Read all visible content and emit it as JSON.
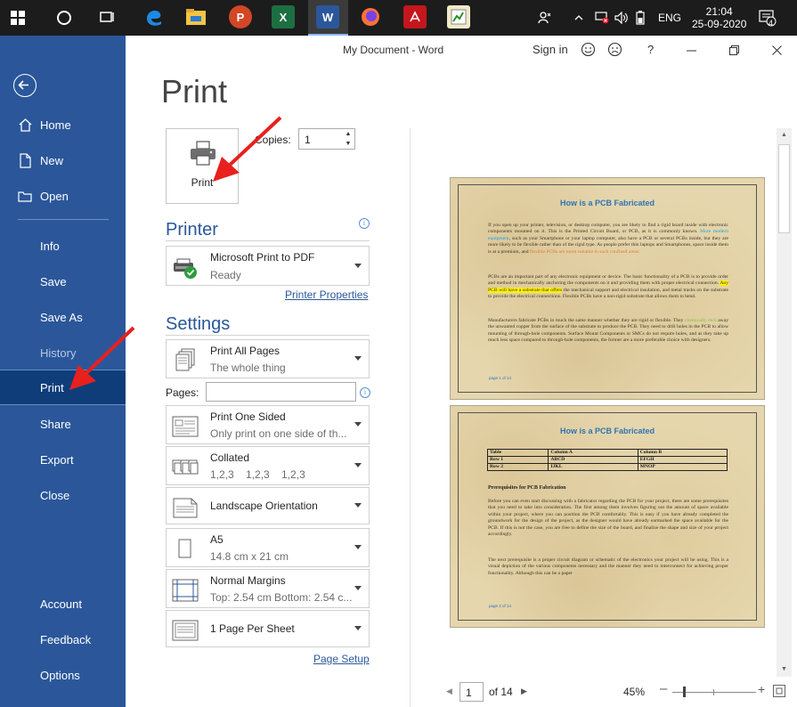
{
  "taskbar": {
    "lang": "ENG",
    "time": "21:04",
    "date": "25-09-2020",
    "notification_count": "4",
    "apps": [
      "edge",
      "file-explorer",
      "powerpoint",
      "excel",
      "word",
      "firefox",
      "acrobat",
      "paint"
    ]
  },
  "titlebar": {
    "document_title": "My Document  -  Word",
    "sign_in": "Sign in",
    "help": "?"
  },
  "nav": {
    "home": "Home",
    "new": "New",
    "open": "Open",
    "info": "Info",
    "save": "Save",
    "save_as": "Save As",
    "history": "History",
    "print": "Print",
    "share": "Share",
    "export": "Export",
    "close": "Close",
    "account": "Account",
    "feedback": "Feedback",
    "options": "Options"
  },
  "print": {
    "page_title": "Print",
    "print_button": "Print",
    "copies_label": "Copies:",
    "copies_value": "1"
  },
  "printer": {
    "section_title": "Printer",
    "name": "Microsoft Print to PDF",
    "status": "Ready",
    "properties_link": "Printer Properties"
  },
  "settings": {
    "section_title": "Settings",
    "pages_label": "Pages:",
    "pages_value": "",
    "items": [
      {
        "main": "Print All Pages",
        "sub": "The whole thing"
      },
      {
        "main": "Print One Sided",
        "sub": "Only print on one side of th..."
      },
      {
        "main": "Collated",
        "sub": "1,2,3    1,2,3    1,2,3"
      },
      {
        "main": "Landscape Orientation",
        "sub": ""
      },
      {
        "main": "A5",
        "sub": "14.8 cm x 21 cm"
      },
      {
        "main": "Normal Margins",
        "sub": "Top: 2.54 cm Bottom: 2.54 c..."
      },
      {
        "main": "1 Page Per Sheet",
        "sub": ""
      }
    ],
    "page_setup_link": "Page Setup"
  },
  "preview": {
    "page1": {
      "title": "How is a PCB Fabricated",
      "p1_a": "If you open up your printer, television, or desktop computer, you are likely to find a rigid board inside with electronic components mounted on it. This is the Printed Circuit Board, or PCB, as it is commonly known. ",
      "p1_b": "More modern equipment",
      "p1_c": ", such as your Smartphone or your laptop computer, also have a PCB or several PCBs inside, but they are more likely to be flexible rather than of the rigid type. As people prefer thin laptops and Smartphones, space inside them is at a premium, and ",
      "p1_d": "flexible PCBs are more suitable in such confined areas.",
      "p2_a": "PCBs are an important part of any electronic equipment or device. The basic functionality of a PCB is to provide order and method in mechanically anchoring the components on it and providing them with proper electrical connection. ",
      "p2_b": "Any PCB will have a substrate that offers",
      "p2_c": " the mechanical support and electrical insulation, and metal tracks on the substrate to provide the electrical connections. Flexible PCBs have a non-rigid substrate that allows them to bend.",
      "p3_a": "Manufacturers fabricate PCBs in much the same manner whether they are rigid or flexible. They ",
      "p3_b": "chemically etch",
      "p3_c": " away the unwanted copper from the surface of the substrate to produce the PCB. They need to drill holes in the PCB to allow mounting of through-hole components. Surface Mount Components or SMCs do not require holes, and as they take up much less space compared to through-hole components, the former are a more preferable choice with designers.",
      "footer": "page 1 of 14"
    },
    "page2": {
      "title": "How is a PCB Fabricated",
      "table": [
        [
          "Table",
          "Column A",
          "Column B"
        ],
        [
          "Row 1",
          "ABCD",
          "EFGH"
        ],
        [
          "Row 2",
          "IJKL",
          "MNOP"
        ]
      ],
      "heading": "Prerequisites for PCB Fabrication",
      "p1": "Before you can even start discussing with a fabricator regarding the PCB for your project, there are some prerequisites that you need to take into consideration. The first among them involves figuring out the amount of space available within your project, where you can position the PCB comfortably. This is easy if you have already completed the groundwork for the design of the project, as the designer would have already earmarked the space available for the PCB. If this is not the case, you are free to define the size of the board, and finalize the shape and size of your project accordingly.",
      "p2": "The next prerequisite is a proper circuit diagram or schematic of the electronics your project will be using. This is a visual depiction of the various components necessary and the manner they need to interconnect for achieving proper functionality. Although this can be a paper",
      "footer": "page 2 of 14"
    }
  },
  "pager": {
    "current_page": "1",
    "of_pages": "of 14",
    "zoom": "45%"
  },
  "colors": {
    "nav_bg": "#2b579a",
    "nav_selected": "#0f3d7a",
    "accent": "#2b579a",
    "annotation_arrow": "#e8201e"
  }
}
